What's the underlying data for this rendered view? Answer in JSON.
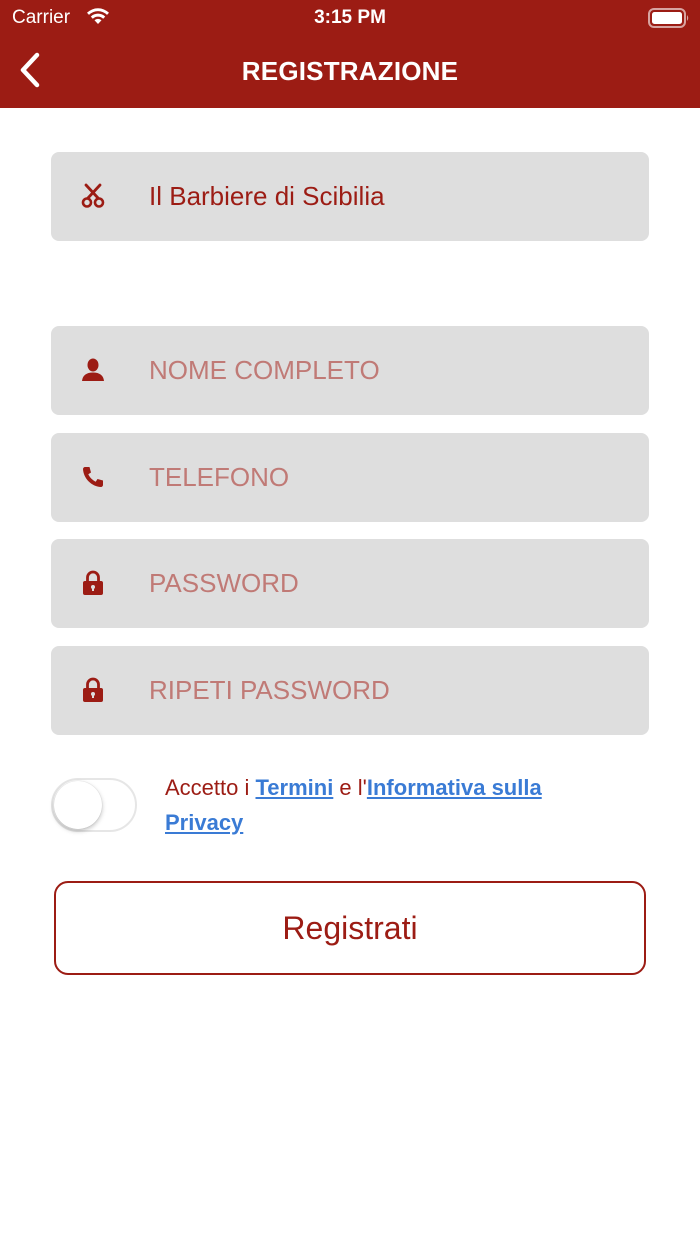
{
  "status_bar": {
    "carrier": "Carrier",
    "time": "3:15 PM"
  },
  "header": {
    "title": "REGISTRAZIONE",
    "back_icon": "chevron-left-icon",
    "background_color": "#9c1c14"
  },
  "form": {
    "shop": {
      "icon": "scissors-icon",
      "value": "Il Barbiere di Scibilia"
    },
    "full_name": {
      "icon": "user-icon",
      "placeholder": "NOME COMPLETO"
    },
    "phone": {
      "icon": "phone-icon",
      "placeholder": "TELEFONO"
    },
    "password": {
      "icon": "lock-icon",
      "placeholder": "PASSWORD"
    },
    "repeat_password": {
      "icon": "lock-icon",
      "placeholder": "RIPETI PASSWORD"
    }
  },
  "consent": {
    "toggle_on": false,
    "prefix": "Accetto i ",
    "terms_link": "Termini",
    "middle": " e l'",
    "privacy_link": "Informativa sulla Privacy"
  },
  "register_button": {
    "label": "Registrati"
  },
  "colors": {
    "accent": "#9c1c14",
    "field_bg": "#dedede",
    "placeholder": "#c07a76",
    "link": "#3a7bd5"
  }
}
